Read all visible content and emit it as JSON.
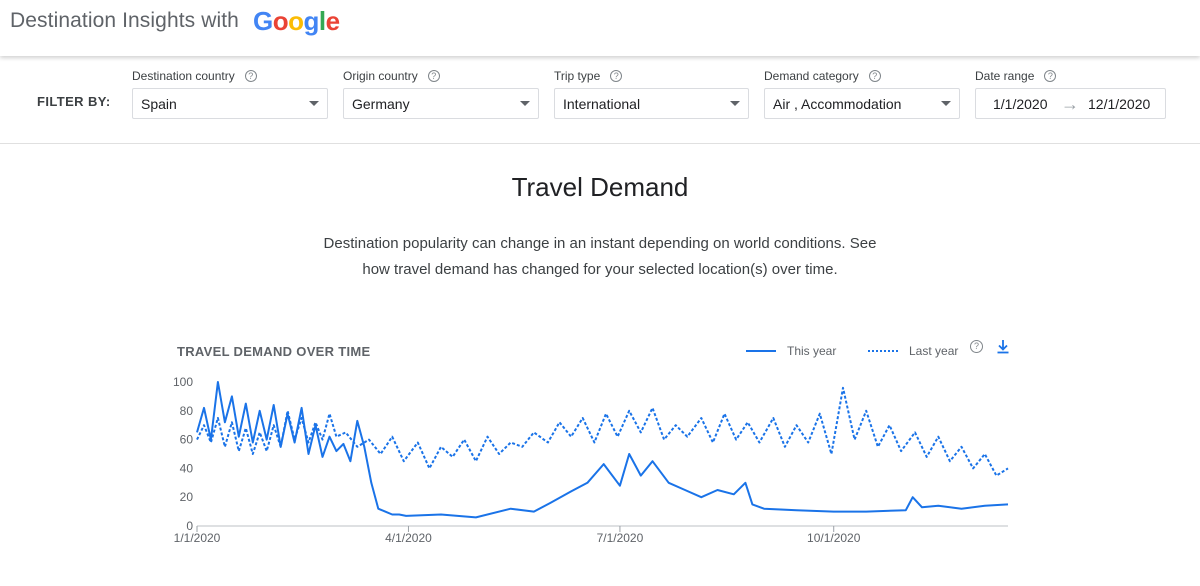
{
  "header": {
    "title": "Destination Insights with",
    "logo_letters": [
      {
        "ch": "G",
        "color": "#4285F4"
      },
      {
        "ch": "o",
        "color": "#EA4335"
      },
      {
        "ch": "o",
        "color": "#FBBC05"
      },
      {
        "ch": "g",
        "color": "#4285F4"
      },
      {
        "ch": "l",
        "color": "#34A853"
      },
      {
        "ch": "e",
        "color": "#EA4335"
      }
    ]
  },
  "filters": {
    "label": "FILTER BY:",
    "destination": {
      "label": "Destination country",
      "value": "Spain"
    },
    "origin": {
      "label": "Origin country",
      "value": "Germany"
    },
    "trip_type": {
      "label": "Trip type",
      "value": "International"
    },
    "demand": {
      "label": "Demand category",
      "value": "Air , Accommodation"
    },
    "date_range": {
      "label": "Date range",
      "start": "1/1/2020",
      "end": "12/1/2020",
      "arrow": "→"
    },
    "help_glyph": "?"
  },
  "section": {
    "title": "Travel Demand",
    "description_line1": "Destination popularity can change in an instant depending on world conditions. See",
    "description_line2": "how travel demand has changed for your selected location(s) over time."
  },
  "chart_panel": {
    "title": "TRAVEL DEMAND OVER TIME",
    "legend_this_year": "This year",
    "legend_last_year": "Last year",
    "help_glyph": "?"
  },
  "colors": {
    "line": "#1a73e8",
    "grid": "#e8eaed",
    "axis_text": "#5f6368"
  },
  "chart_data": {
    "type": "line",
    "title": "TRAVEL DEMAND OVER TIME",
    "xlabel": "",
    "ylabel": "",
    "ylim": [
      0,
      100
    ],
    "yticks": [
      0,
      20,
      40,
      60,
      80,
      100
    ],
    "xlim": [
      "2020-01-01",
      "2020-12-15"
    ],
    "xticks": [
      {
        "date": "2020-01-01",
        "label": "1/1/2020"
      },
      {
        "date": "2020-04-01",
        "label": "4/1/2020"
      },
      {
        "date": "2020-07-01",
        "label": "7/1/2020"
      },
      {
        "date": "2020-10-01",
        "label": "10/1/2020"
      }
    ],
    "grid": false,
    "legend": "top-right",
    "series": [
      {
        "name": "This year",
        "style": "solid",
        "x": [
          "2020-01-01",
          "2020-01-04",
          "2020-01-07",
          "2020-01-10",
          "2020-01-13",
          "2020-01-16",
          "2020-01-19",
          "2020-01-22",
          "2020-01-25",
          "2020-01-28",
          "2020-01-31",
          "2020-02-03",
          "2020-02-06",
          "2020-02-09",
          "2020-02-12",
          "2020-02-15",
          "2020-02-18",
          "2020-02-21",
          "2020-02-24",
          "2020-02-27",
          "2020-03-01",
          "2020-03-04",
          "2020-03-07",
          "2020-03-10",
          "2020-03-13",
          "2020-03-16",
          "2020-03-19",
          "2020-03-22",
          "2020-03-25",
          "2020-03-28",
          "2020-03-31",
          "2020-04-15",
          "2020-04-30",
          "2020-05-15",
          "2020-05-25",
          "2020-06-01",
          "2020-06-10",
          "2020-06-17",
          "2020-06-24",
          "2020-07-01",
          "2020-07-05",
          "2020-07-10",
          "2020-07-15",
          "2020-07-22",
          "2020-07-29",
          "2020-08-05",
          "2020-08-12",
          "2020-08-19",
          "2020-08-24",
          "2020-08-27",
          "2020-09-01",
          "2020-09-15",
          "2020-10-01",
          "2020-10-15",
          "2020-11-01",
          "2020-11-04",
          "2020-11-08",
          "2020-11-15",
          "2020-11-25",
          "2020-12-05",
          "2020-12-15"
        ],
        "y": [
          65,
          82,
          60,
          100,
          72,
          90,
          62,
          85,
          58,
          80,
          60,
          84,
          55,
          78,
          58,
          82,
          50,
          70,
          48,
          62,
          52,
          57,
          45,
          73,
          55,
          30,
          12,
          10,
          8,
          8,
          7,
          8,
          6,
          12,
          10,
          16,
          24,
          30,
          43,
          28,
          50,
          35,
          45,
          30,
          25,
          20,
          25,
          22,
          30,
          15,
          12,
          11,
          10,
          10,
          11,
          20,
          13,
          14,
          12,
          14,
          15
        ]
      },
      {
        "name": "Last year",
        "style": "dashed",
        "x": [
          "2020-01-01",
          "2020-01-04",
          "2020-01-07",
          "2020-01-10",
          "2020-01-13",
          "2020-01-16",
          "2020-01-19",
          "2020-01-22",
          "2020-01-25",
          "2020-01-28",
          "2020-01-31",
          "2020-02-03",
          "2020-02-06",
          "2020-02-09",
          "2020-02-12",
          "2020-02-15",
          "2020-02-18",
          "2020-02-21",
          "2020-02-24",
          "2020-02-27",
          "2020-03-01",
          "2020-03-05",
          "2020-03-10",
          "2020-03-15",
          "2020-03-20",
          "2020-03-25",
          "2020-03-30",
          "2020-04-05",
          "2020-04-10",
          "2020-04-15",
          "2020-04-20",
          "2020-04-25",
          "2020-04-30",
          "2020-05-05",
          "2020-05-10",
          "2020-05-15",
          "2020-05-20",
          "2020-05-25",
          "2020-05-31",
          "2020-06-05",
          "2020-06-10",
          "2020-06-15",
          "2020-06-20",
          "2020-06-25",
          "2020-06-30",
          "2020-07-05",
          "2020-07-10",
          "2020-07-15",
          "2020-07-20",
          "2020-07-25",
          "2020-07-30",
          "2020-08-05",
          "2020-08-10",
          "2020-08-15",
          "2020-08-20",
          "2020-08-25",
          "2020-08-30",
          "2020-09-05",
          "2020-09-10",
          "2020-09-15",
          "2020-09-20",
          "2020-09-25",
          "2020-09-30",
          "2020-10-05",
          "2020-10-10",
          "2020-10-15",
          "2020-10-20",
          "2020-10-25",
          "2020-10-30",
          "2020-11-05",
          "2020-11-10",
          "2020-11-15",
          "2020-11-20",
          "2020-11-25",
          "2020-11-30",
          "2020-12-05",
          "2020-12-10",
          "2020-12-15"
        ],
        "y": [
          60,
          70,
          58,
          75,
          55,
          72,
          52,
          68,
          50,
          65,
          52,
          70,
          55,
          80,
          60,
          75,
          58,
          72,
          60,
          78,
          62,
          65,
          55,
          60,
          50,
          62,
          45,
          58,
          40,
          55,
          48,
          60,
          45,
          62,
          50,
          58,
          55,
          65,
          58,
          72,
          62,
          75,
          58,
          78,
          62,
          80,
          65,
          82,
          60,
          70,
          62,
          75,
          58,
          78,
          60,
          72,
          58,
          75,
          55,
          70,
          58,
          78,
          50,
          96,
          60,
          80,
          55,
          70,
          52,
          65,
          48,
          62,
          45,
          55,
          40,
          50,
          35,
          40
        ]
      }
    ]
  }
}
